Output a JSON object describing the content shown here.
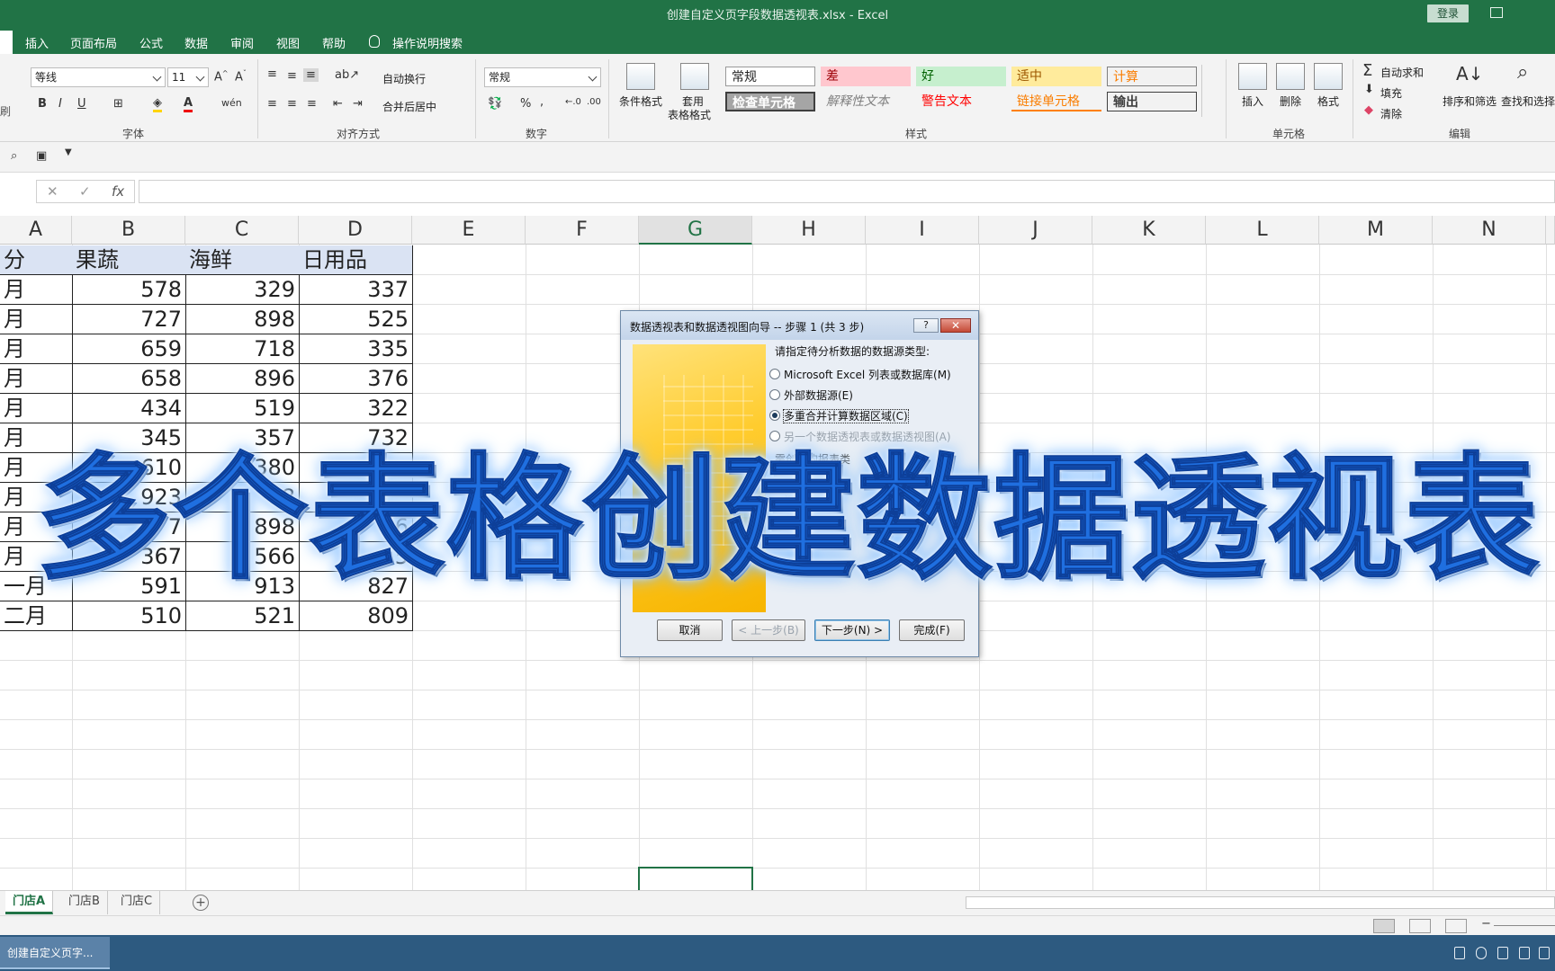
{
  "window": {
    "title": "创建自定义页字段数据透视表.xlsx  -  Excel",
    "login_label": "登录"
  },
  "menu": {
    "items": [
      "插入",
      "页面布局",
      "公式",
      "数据",
      "审阅",
      "视图",
      "帮助"
    ],
    "tell_me": "操作说明搜索"
  },
  "ribbon": {
    "font_name": "等线",
    "font_size": "11",
    "font_group": "字体",
    "wrap_text": "自动换行",
    "merge_center": "合并后居中",
    "align_group": "对齐方式",
    "number_format": "常规",
    "number_group": "数字",
    "conditional_format": "条件格式",
    "format_table_1": "套用",
    "format_table_2": "表格格式",
    "styles": {
      "normal": "常规",
      "bad": "差",
      "good": "好",
      "neutral": "适中",
      "calculation": "计算",
      "check_cell": "检查单元格",
      "explanatory": "解释性文本",
      "warning": "警告文本",
      "linked_cell": "链接单元格",
      "output": "输出"
    },
    "styles_group": "样式",
    "insert": "插入",
    "delete": "删除",
    "format": "格式",
    "cells_group": "单元格",
    "autosum": "自动求和",
    "fill": "填充",
    "clear": "清除",
    "sort_filter": "排序和筛选",
    "find_select": "查找和选择",
    "edit_group": "编辑"
  },
  "formula_bar": {
    "fx": "fx",
    "cancel": "✕",
    "enter": "✓"
  },
  "columns": [
    "A",
    "B",
    "C",
    "D",
    "E",
    "F",
    "G",
    "H",
    "I",
    "J",
    "K",
    "L",
    "M",
    "N"
  ],
  "table": {
    "headers": [
      "分",
      "果蔬",
      "海鲜",
      "日用品"
    ],
    "rows": [
      [
        "月",
        "578",
        "329",
        "337"
      ],
      [
        "月",
        "727",
        "898",
        "525"
      ],
      [
        "月",
        "659",
        "718",
        "335"
      ],
      [
        "月",
        "658",
        "896",
        "376"
      ],
      [
        "月",
        "434",
        "519",
        "322"
      ],
      [
        "月",
        "345",
        "357",
        "732"
      ],
      [
        "月",
        "610",
        "380",
        ""
      ],
      [
        "月",
        "923",
        "8",
        ""
      ],
      [
        "月",
        "7",
        "898",
        "6"
      ],
      [
        "月",
        "367",
        "566",
        "5"
      ],
      [
        "一月",
        "591",
        "913",
        "827"
      ],
      [
        "二月",
        "510",
        "521",
        "809"
      ]
    ]
  },
  "sheets": [
    "门店A",
    "门店B",
    "门店C"
  ],
  "dialog": {
    "title": "数据透视表和数据透视图向导 -- 步骤 1 (共 3 步)",
    "help": "?",
    "close": "✕",
    "prompt": "请指定待分析数据的数据源类型:",
    "options": [
      "Microsoft Excel 列表或数据库(M)",
      "外部数据源(E)",
      "多重合并计算数据区域(C)",
      "另一个数据透视表或数据透视图(A)"
    ],
    "selected_index": 2,
    "partial_lines": [
      "需创建的报表类",
      "视表"
    ],
    "buttons": {
      "cancel": "取消",
      "back": "< 上一步(B)",
      "next": "下一步(N) >",
      "finish": "完成(F)"
    }
  },
  "overlay_caption": "多个表格创建数据透视表",
  "taskbar": {
    "app_item": "创建自定义页字..."
  },
  "colors": {
    "excel_green": "#217346",
    "header_fill": "#dae3f3",
    "caption_blue": "#1f6fe0"
  }
}
